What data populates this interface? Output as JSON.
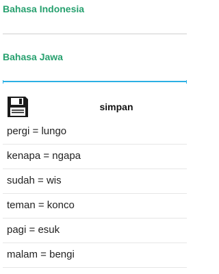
{
  "form": {
    "indonesia_label": "Bahasa Indonesia",
    "indonesia_value": "",
    "jawa_label": "Bahasa Jawa",
    "jawa_value": "",
    "accent_color": "#26a06e",
    "focus_color": "#2bb0e4"
  },
  "save": {
    "icon": "floppy-disk-icon",
    "label": "simpan"
  },
  "words": [
    {
      "text": "pergi = lungo"
    },
    {
      "text": "kenapa = ngapa"
    },
    {
      "text": "sudah = wis"
    },
    {
      "text": "teman = konco"
    },
    {
      "text": "pagi = esuk"
    },
    {
      "text": "malam = bengi"
    }
  ]
}
